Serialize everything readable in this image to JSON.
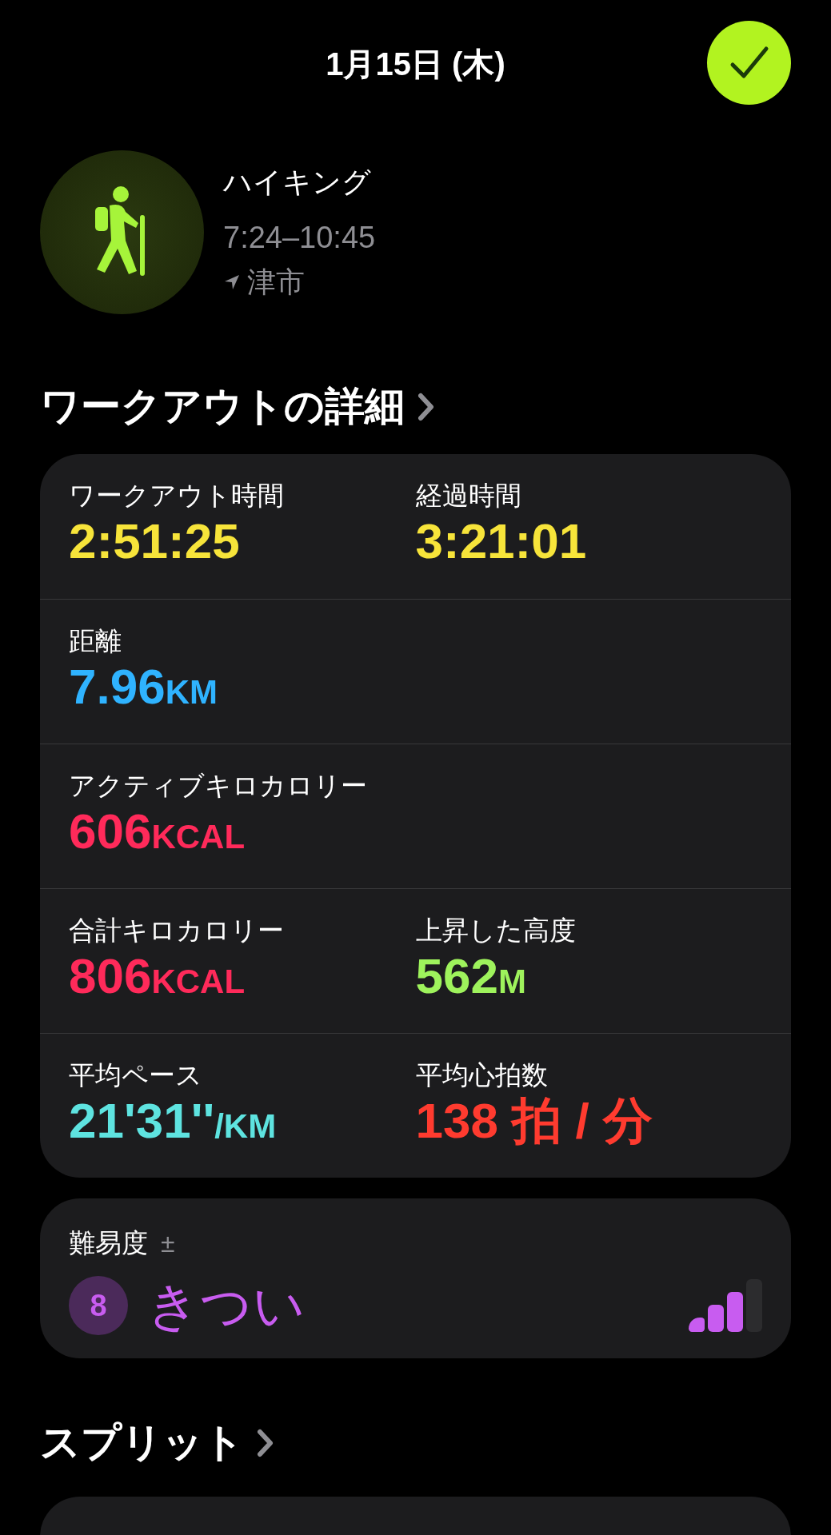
{
  "header": {
    "date": "1月15日 (木)"
  },
  "workout": {
    "name": "ハイキング",
    "time": "7:24–10:45",
    "location": "津市"
  },
  "details": {
    "title": "ワークアウトの詳細",
    "rows": [
      [
        {
          "label": "ワークアウト時間",
          "value": "2:51:25",
          "color": "#f7e43a"
        },
        {
          "label": "経過時間",
          "value": "3:21:01",
          "color": "#f7e43a"
        }
      ],
      [
        {
          "label": "距離",
          "value": "7.96",
          "unit": "KM",
          "color": "#2fb3ff"
        }
      ],
      [
        {
          "label": "アクティブキロカロリー",
          "value": "606",
          "unit": "KCAL",
          "color": "#ff2a5a"
        }
      ],
      [
        {
          "label": "合計キロカロリー",
          "value": "806",
          "unit": "KCAL",
          "color": "#ff2a5a"
        },
        {
          "label": "上昇した高度",
          "value": "562",
          "unit": "M",
          "color": "#9ef25c"
        }
      ],
      [
        {
          "label": "平均ペース",
          "value": "21'31''",
          "unit": "/KM",
          "color": "#5ee3e0"
        },
        {
          "label": "平均心拍数",
          "value": "138 拍 / 分",
          "color": "#ff3b2f"
        }
      ]
    ]
  },
  "difficulty": {
    "label": "難易度",
    "adjust": "±",
    "score": "8",
    "rating": "きつい",
    "level": 0.75
  },
  "splits": {
    "title": "スプリット"
  }
}
